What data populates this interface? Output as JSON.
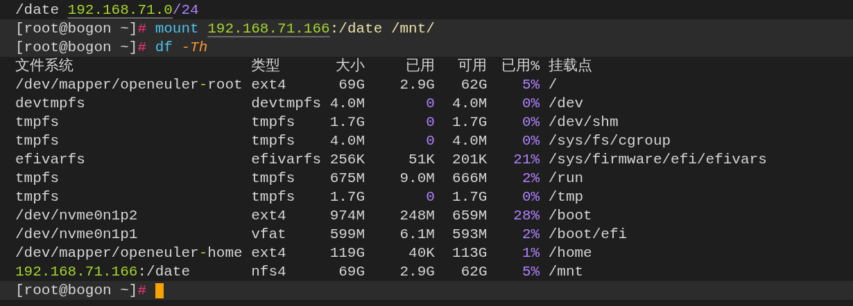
{
  "terminal": {
    "before": [
      {
        "highlighted": false,
        "words": [
          [
            {
              "text": "/date",
              "kind": "plain"
            }
          ],
          [
            {
              "text": "192.168.71.0",
              "kind": "link"
            },
            {
              "text": "/24",
              "kind": "number"
            }
          ]
        ]
      },
      {
        "highlighted": true,
        "words": [
          [
            {
              "text": "[root@bogon ~]",
              "kind": "plain"
            },
            {
              "text": "#",
              "kind": "hash"
            }
          ],
          [
            {
              "text": "mount",
              "kind": "command"
            }
          ],
          [
            {
              "text": "192.168.71.166",
              "kind": "link"
            },
            {
              "text": ":/date /mnt/",
              "kind": "path"
            }
          ]
        ]
      },
      {
        "highlighted": true,
        "words": [
          [
            {
              "text": "[root@bogon ~]",
              "kind": "plain"
            },
            {
              "text": "#",
              "kind": "hash"
            }
          ],
          [
            {
              "text": "df",
              "kind": "command"
            }
          ],
          [
            {
              "text": "-Th",
              "kind": "option"
            }
          ]
        ]
      }
    ],
    "df_table": {
      "columns": [
        "文件系统",
        "类型",
        "大小",
        "已用",
        "可用",
        "已用%",
        "挂载点"
      ],
      "rows": [
        {
          "cells": [
            [
              {
                "text": "/dev/mapper/openeuler",
                "kind": "plain"
              },
              {
                "text": "-",
                "kind": "accent"
              },
              {
                "text": "root",
                "kind": "plain"
              }
            ],
            "ext4",
            "69G",
            "2.9G",
            "62G",
            [
              {
                "text": "5%",
                "kind": "number"
              }
            ],
            "/"
          ]
        },
        {
          "cells": [
            "devtmpfs",
            "devtmpfs",
            "4.0M",
            [
              {
                "text": "0",
                "kind": "number"
              }
            ],
            "4.0M",
            [
              {
                "text": "0%",
                "kind": "number"
              }
            ],
            "/dev"
          ]
        },
        {
          "cells": [
            "tmpfs",
            "tmpfs",
            "1.7G",
            [
              {
                "text": "0",
                "kind": "number"
              }
            ],
            "1.7G",
            [
              {
                "text": "0%",
                "kind": "number"
              }
            ],
            "/dev/shm"
          ]
        },
        {
          "cells": [
            "tmpfs",
            "tmpfs",
            "4.0M",
            [
              {
                "text": "0",
                "kind": "number"
              }
            ],
            "4.0M",
            [
              {
                "text": "0%",
                "kind": "number"
              }
            ],
            "/sys/fs/cgroup"
          ]
        },
        {
          "cells": [
            "efivarfs",
            "efivarfs",
            "256K",
            "51K",
            "201K",
            [
              {
                "text": "21%",
                "kind": "number"
              }
            ],
            "/sys/firmware/efi/efivars"
          ]
        },
        {
          "cells": [
            "tmpfs",
            "tmpfs",
            "675M",
            "9.0M",
            "666M",
            [
              {
                "text": "2%",
                "kind": "number"
              }
            ],
            "/run"
          ]
        },
        {
          "cells": [
            "tmpfs",
            "tmpfs",
            "1.7G",
            [
              {
                "text": "0",
                "kind": "number"
              }
            ],
            "1.7G",
            [
              {
                "text": "0%",
                "kind": "number"
              }
            ],
            "/tmp"
          ]
        },
        {
          "cells": [
            "/dev/nvme0n1p2",
            "ext4",
            "974M",
            "248M",
            "659M",
            [
              {
                "text": "28%",
                "kind": "number"
              }
            ],
            "/boot"
          ]
        },
        {
          "cells": [
            "/dev/nvme0n1p1",
            "vfat",
            "599M",
            "6.1M",
            "593M",
            [
              {
                "text": "2%",
                "kind": "number"
              }
            ],
            "/boot/efi"
          ]
        },
        {
          "cells": [
            [
              {
                "text": "/dev/mapper/openeuler",
                "kind": "plain"
              },
              {
                "text": "-",
                "kind": "accent"
              },
              {
                "text": "home",
                "kind": "plain"
              }
            ],
            "ext4",
            "119G",
            "40K",
            "113G",
            [
              {
                "text": "1%",
                "kind": "number"
              }
            ],
            "/home"
          ]
        },
        {
          "cells": [
            [
              {
                "text": "192.168.71.166",
                "kind": "accent"
              },
              {
                "text": ":/date",
                "kind": "plain"
              }
            ],
            "nfs4",
            "69G",
            "2.9G",
            "62G",
            [
              {
                "text": "5%",
                "kind": "number"
              }
            ],
            "/mnt"
          ]
        }
      ]
    },
    "after": [
      {
        "highlighted": true,
        "cursor": true,
        "words": [
          [
            {
              "text": "[root@bogon ~]",
              "kind": "plain"
            },
            {
              "text": "#",
              "kind": "hash"
            }
          ]
        ]
      }
    ]
  }
}
